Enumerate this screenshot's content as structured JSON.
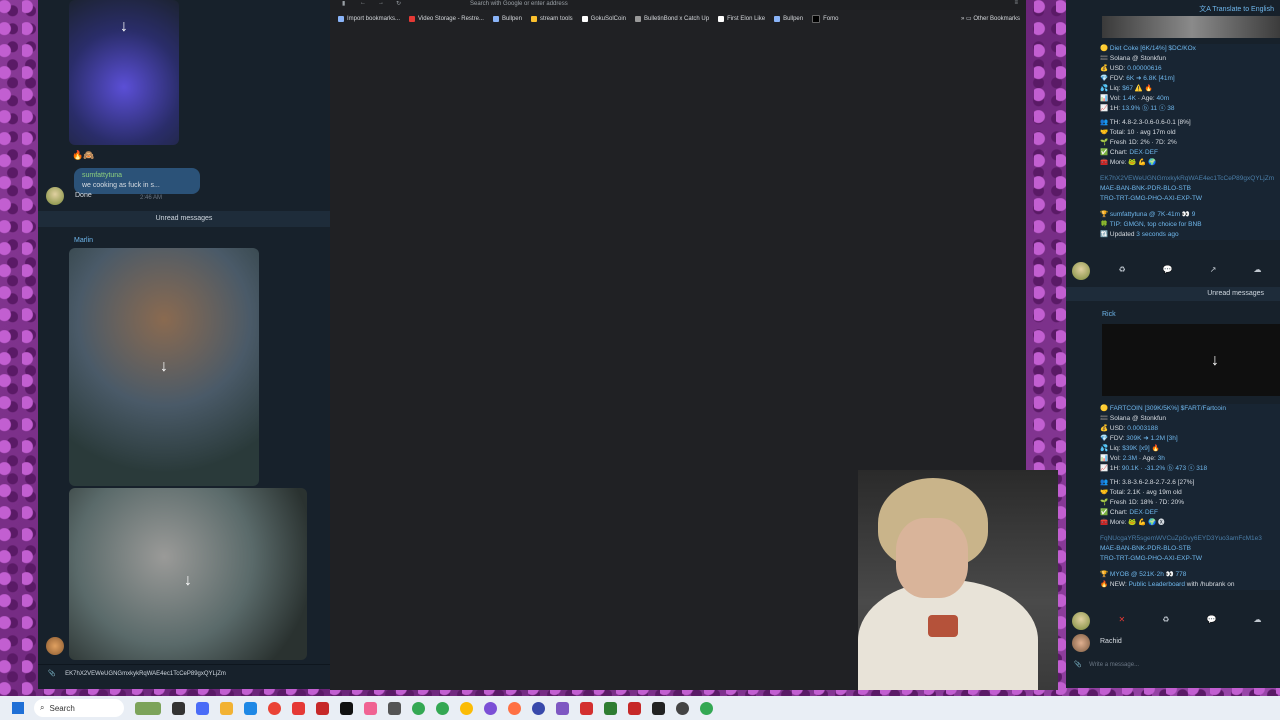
{
  "left_chat": {
    "reply": {
      "sender": "sumfattytuna",
      "text": "we cooking as fuck in s...",
      "message": "Done",
      "time": "2:46 AM"
    },
    "unread_label": "Unread messages",
    "sender2": "Marlin",
    "input_text": "EK7hX2VEWeUGNGmxkykRqWAE4ec1TcCeP89gxQYLjZm"
  },
  "browser": {
    "address_placeholder": "Search with Google or enter address",
    "bookmarks": [
      "Import bookmarks...",
      "Video Storage - Restre...",
      "Bullpen",
      "stream tools",
      "GokuSolCoin",
      "BulletinBond x Catch Up",
      "First Elon Like",
      "Bullpen",
      "Fomo"
    ],
    "other_bookmarks": "Other Bookmarks"
  },
  "right_chat": {
    "translate": "Translate to English",
    "card1": {
      "title": "Diet Coke [6K/14%] $DC/KOx",
      "chain": "Solana @ Stonkfun",
      "usd_label": "USD:",
      "usd": "0.00000616",
      "fdv_label": "FDV:",
      "fdv": "6K ➜ 6.8K [41m]",
      "liq_label": "Liq:",
      "liq": "$67",
      "vol_label": "Vol:",
      "vol": "1.4K",
      "age_label": "Age:",
      "age": "40m",
      "h1_label": "1H:",
      "h1": "13.9% ⓑ 11 ⓢ 38",
      "th": "TH: 4.8-2.3-0.6-0.6-0.1 [8%]",
      "total_label": "Total:",
      "total": "10 · avg 17m old",
      "fresh_label": "Fresh 1D:",
      "fresh": "2% · 7D: 2%",
      "chart_label": "Chart:",
      "chart": "DEX·DEF",
      "more": "More:",
      "hash": "EK7hX2VEWeUGNGmxkykRqWAE4ec1TcCeP89gxQYLjZm",
      "cmds1": "MAE-BAN-BNK-PDR-BLO-STB",
      "cmds2": "TRO-TRT-GMG-PHO-AXI-EXP-TW",
      "user": "sumfattytuna @ 7K·41m 👀 9",
      "tip": "TIP: GMGN, top choice for BNB",
      "updated_label": "Updated",
      "updated": "3 seconds ago"
    },
    "unread_label": "Unread messages",
    "sender_rick": "Rick",
    "card2": {
      "title": "FARTCOIN [309K/5K%] $FART/Fartcoin",
      "chain": "Solana @ Stonkfun",
      "usd_label": "USD:",
      "usd": "0.0003188",
      "fdv_label": "FDV:",
      "fdv": "309K ➜ 1.2M [3h]",
      "liq_label": "Liq:",
      "liq": "$39K [x9]",
      "vol_label": "Vol:",
      "vol": "2.3M",
      "age_label": "Age:",
      "age": "3h",
      "h1_label": "1H:",
      "h1": "90.1K · -31.2% ⓑ 473 ⓢ 318",
      "th": "TH: 3.8-3.6-2.8-2.7-2.6 [27%]",
      "total_label": "Total:",
      "total": "2.1K · avg 19m old",
      "fresh_label": "Fresh 1D:",
      "fresh": "18% · 7D: 20%",
      "chart_label": "Chart:",
      "chart": "DEX·DEF",
      "more": "More:",
      "hash": "FqNUcgaYR5sgemWVCuZpGvy6EYD3Yuo3amFcM1e3",
      "cmds1": "MAE-BAN-BNK-PDR-BLO-STB",
      "cmds2": "TRO-TRT-GMG-PHO-AXI-EXP-TW",
      "user": "MYOB @ 521K·2h 👀 778",
      "tip_prefix": "NEW:",
      "tip": "Public Leaderboard",
      "tip_suffix": "with /hubrank on"
    },
    "sender_rachid": "Rachid",
    "input_placeholder": "Write a message..."
  },
  "taskbar": {
    "search": "Search"
  },
  "colors": {
    "telegram_bg": "#17212b",
    "accent": "#6fb7ec",
    "taskbar": "#e9eef5"
  }
}
